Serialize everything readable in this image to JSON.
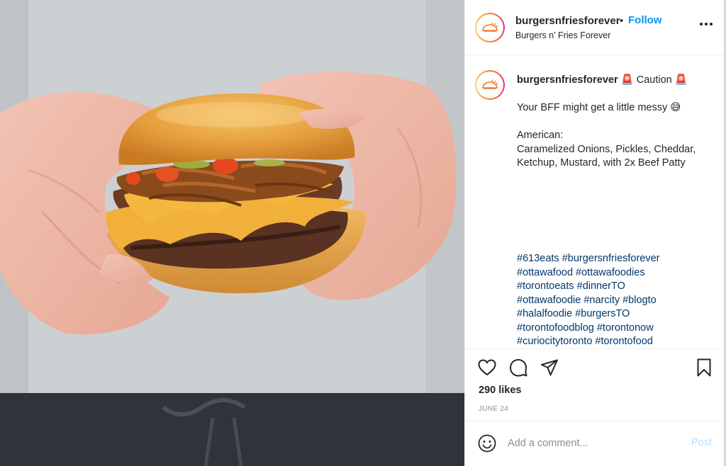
{
  "post": {
    "username": "burgersnfriesforever",
    "separator": "•",
    "follow_label": "Follow",
    "subtitle": "Burgers n' Fries Forever",
    "more_icon": "more-options-icon"
  },
  "caption": {
    "author": "burgersnfriesforever",
    "emoji_siren": "🚨",
    "caution": "Caution",
    "line_messy": "Your BFF might get a little messy",
    "emoji_messy": "😅",
    "line_style": "American:",
    "line_ingredients_1": "Caramelized Onions, Pickles, Cheddar,",
    "line_ingredients_2": "Ketchup, Mustard, with 2x Beef Patty"
  },
  "hashtags": [
    "#613eats #burgersnfriesforever",
    "#ottawafood #ottawafoodies",
    "#torontoeats #dinnerTO",
    "#ottawafoodie #narcity #blogto",
    "#halalfoodie #burgersTO",
    "#torontofoodblog #torontonow",
    "#curiocitytoronto #torontofood"
  ],
  "actions": {
    "like_icon": "heart-icon",
    "comment_icon": "comment-icon",
    "share_icon": "share-icon",
    "save_icon": "bookmark-icon",
    "likes": "290 likes",
    "date": "JUNE 24"
  },
  "comment_box": {
    "emoji_icon": "emoji-icon",
    "placeholder": "Add a comment...",
    "post_label": "Post"
  },
  "colors": {
    "accent": "#0095f6",
    "hashtag": "#00376b",
    "post_disabled": "#b2dffc",
    "muted": "#8e8e8e"
  }
}
